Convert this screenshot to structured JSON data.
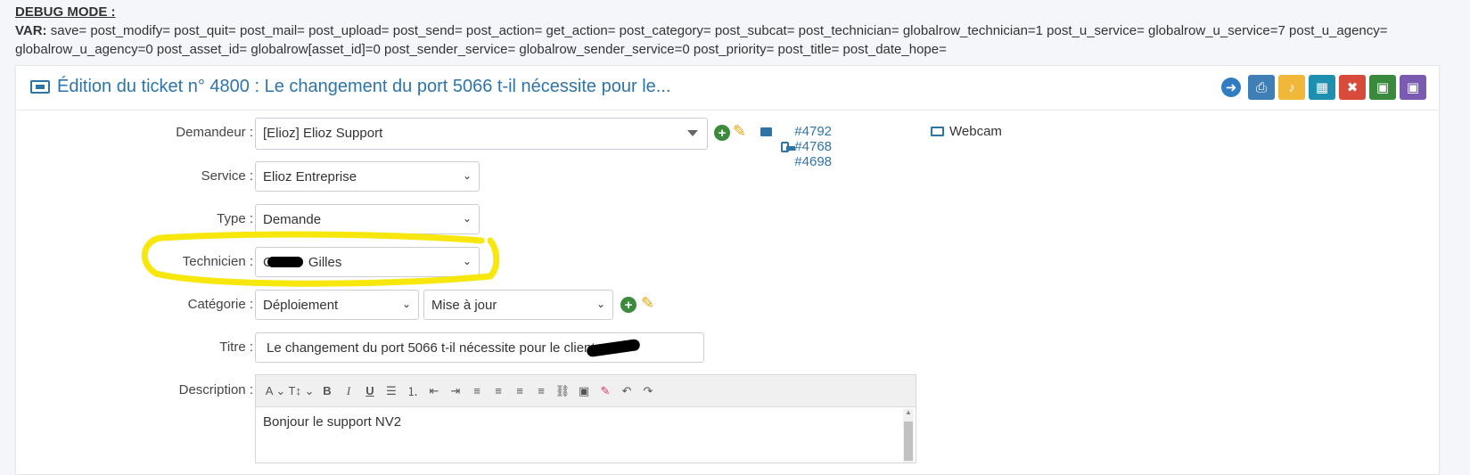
{
  "debug": {
    "title": "DEBUG MODE :",
    "var_label": "VAR:",
    "var_text": " save= post_modify= post_quit= post_mail= post_upload= post_send= post_action= get_action= post_category= post_subcat= post_technician= globalrow_technician=1 post_u_service= globalrow_u_service=7 post_u_agency= globalrow_u_agency=0 post_asset_id= globalrow[asset_id]=0 post_sender_service= globalrow_sender_service=0 post_priority= post_title= post_date_hope="
  },
  "header": {
    "title": "Édition du ticket n° 4800 : Le changement du port 5066 t-il nécessite pour le..."
  },
  "toolbar": {
    "buttons": [
      {
        "name": "print-icon",
        "color": "#3f7fb5",
        "glyph": "⎙"
      },
      {
        "name": "bell-icon",
        "color": "#f0b73a",
        "glyph": "🔔"
      },
      {
        "name": "calendar-icon",
        "color": "#1f8fb0",
        "glyph": "▦"
      },
      {
        "name": "trash-icon",
        "color": "#d84b3a",
        "glyph": "🗑"
      },
      {
        "name": "save-icon",
        "color": "#3a8a3d",
        "glyph": "💾"
      },
      {
        "name": "save-quit-icon",
        "color": "#7a5bb0",
        "glyph": "💾"
      }
    ]
  },
  "form": {
    "demandeur": {
      "label": "Demandeur :",
      "value": "[Elioz] Elioz Support"
    },
    "demandeur_links": {
      "tickets": "#4792 #4768 #4698",
      "webcam": "Webcam"
    },
    "service": {
      "label": "Service :",
      "value": "Elioz Entreprise"
    },
    "type": {
      "label": "Type :",
      "value": "Demande"
    },
    "technicien": {
      "label": "Technicien :",
      "value_prefix": "C",
      "value_suffix": "Gilles"
    },
    "categorie": {
      "label": "Catégorie :",
      "value": "Déploiement",
      "subcat": "Mise à jour"
    },
    "titre": {
      "label": "Titre :",
      "value": "Le changement du port 5066 t-il nécessite pour le client"
    },
    "description": {
      "label": "Description :",
      "value": "Bonjour le support NV2"
    }
  },
  "editor_toolbar": [
    "A ⌄",
    "T↕ ⌄",
    "B",
    "I",
    "U",
    "☰",
    "⒈",
    "⇤",
    "⇥",
    "≡",
    "≡",
    "≡",
    "≡",
    "🔗",
    "▣",
    "🖌",
    "↶",
    "↷"
  ],
  "colors": {
    "accent": "#2e74a8",
    "highlight": "#f7e600"
  }
}
